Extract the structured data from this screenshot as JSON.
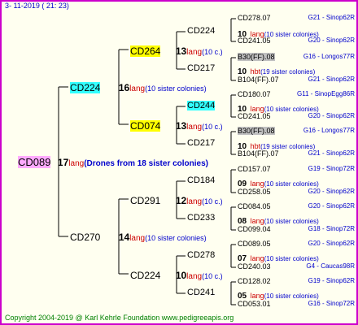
{
  "date": "3- 11-2019 ( 21: 23)",
  "footer": "Copyright 2004-2019 @ Karl Kehrle Foundation    www.pedigreeapis.org",
  "root": {
    "name": "CD089",
    "num": "17",
    "lang": "lang",
    "note": "(Drones from 18 sister colonies)"
  },
  "sire": {
    "name": "CD224",
    "num": "16",
    "lang": "lang",
    "note": "(10 sister colonies)"
  },
  "dam": {
    "name": "CD270",
    "num": "14",
    "lang": "lang",
    "note": "(10 sister colonies)"
  },
  "g3": [
    {
      "name": "CD264",
      "num": "13",
      "lang": "lang",
      "note": "(10 c.)"
    },
    {
      "name": "CD074",
      "num": "13",
      "lang": "lang",
      "note": "(10 c.)"
    },
    {
      "name": "CD291",
      "num": "12",
      "lang": "lang",
      "note": "(10 c.)"
    },
    {
      "name": "CD224",
      "num": "10",
      "lang": "lang",
      "note": "(10 c.)"
    }
  ],
  "g4": [
    {
      "name": "CD224",
      "num": "10",
      "lang": "lang",
      "note": "(10 sister colonies)"
    },
    {
      "name": "CD217",
      "num": "10",
      "lang": "hbt",
      "note": "(19 sister colonies)"
    },
    {
      "name": "CD244",
      "num": "10",
      "lang": "lang",
      "note": "(10 sister colonies)"
    },
    {
      "name": "CD217",
      "num": "10",
      "lang": "hbt",
      "note": "(19 sister colonies)"
    },
    {
      "name": "CD184",
      "num": "09",
      "lang": "lang",
      "note": "(10 sister colonies)"
    },
    {
      "name": "CD233",
      "num": "08",
      "lang": "lang",
      "note": "(10 sister colonies)"
    },
    {
      "name": "CD278",
      "num": "07",
      "lang": "lang",
      "note": "(10 sister colonies)"
    },
    {
      "name": "CD241",
      "num": "05",
      "lang": "lang",
      "note": "(10 sister colonies)"
    }
  ],
  "g5": [
    {
      "name": "CD278.07",
      "orig": "G21 - Sinop62R"
    },
    {
      "name": "CD241.05",
      "orig": "G20 - Sinop62R"
    },
    {
      "name": "B30(FF).08",
      "orig": "G16 - Longos77R"
    },
    {
      "name": "B104(FF).07",
      "orig": "G21 - Sinop62R"
    },
    {
      "name": "CD180.07",
      "orig": "G11 - SinopEgg86R"
    },
    {
      "name": "CD241.05",
      "orig": "G20 - Sinop62R"
    },
    {
      "name": "B30(FF).08",
      "orig": "G16 - Longos77R"
    },
    {
      "name": "B104(FF).07",
      "orig": "G21 - Sinop62R"
    },
    {
      "name": "CD157.07",
      "orig": "G19 - Sinop72R"
    },
    {
      "name": "CD258.05",
      "orig": "G20 - Sinop62R"
    },
    {
      "name": "CD084.05",
      "orig": "G20 - Sinop62R"
    },
    {
      "name": "CD099.04",
      "orig": "G18 - Sinop72R"
    },
    {
      "name": "CD089.05",
      "orig": "G20 - Sinop62R"
    },
    {
      "name": "CD240.03",
      "orig": "G4 - Caucas98R"
    },
    {
      "name": "CD128.02",
      "orig": "G19 - Sinop62R"
    },
    {
      "name": "CD053.01",
      "orig": "G16 - Sinop72R"
    }
  ]
}
